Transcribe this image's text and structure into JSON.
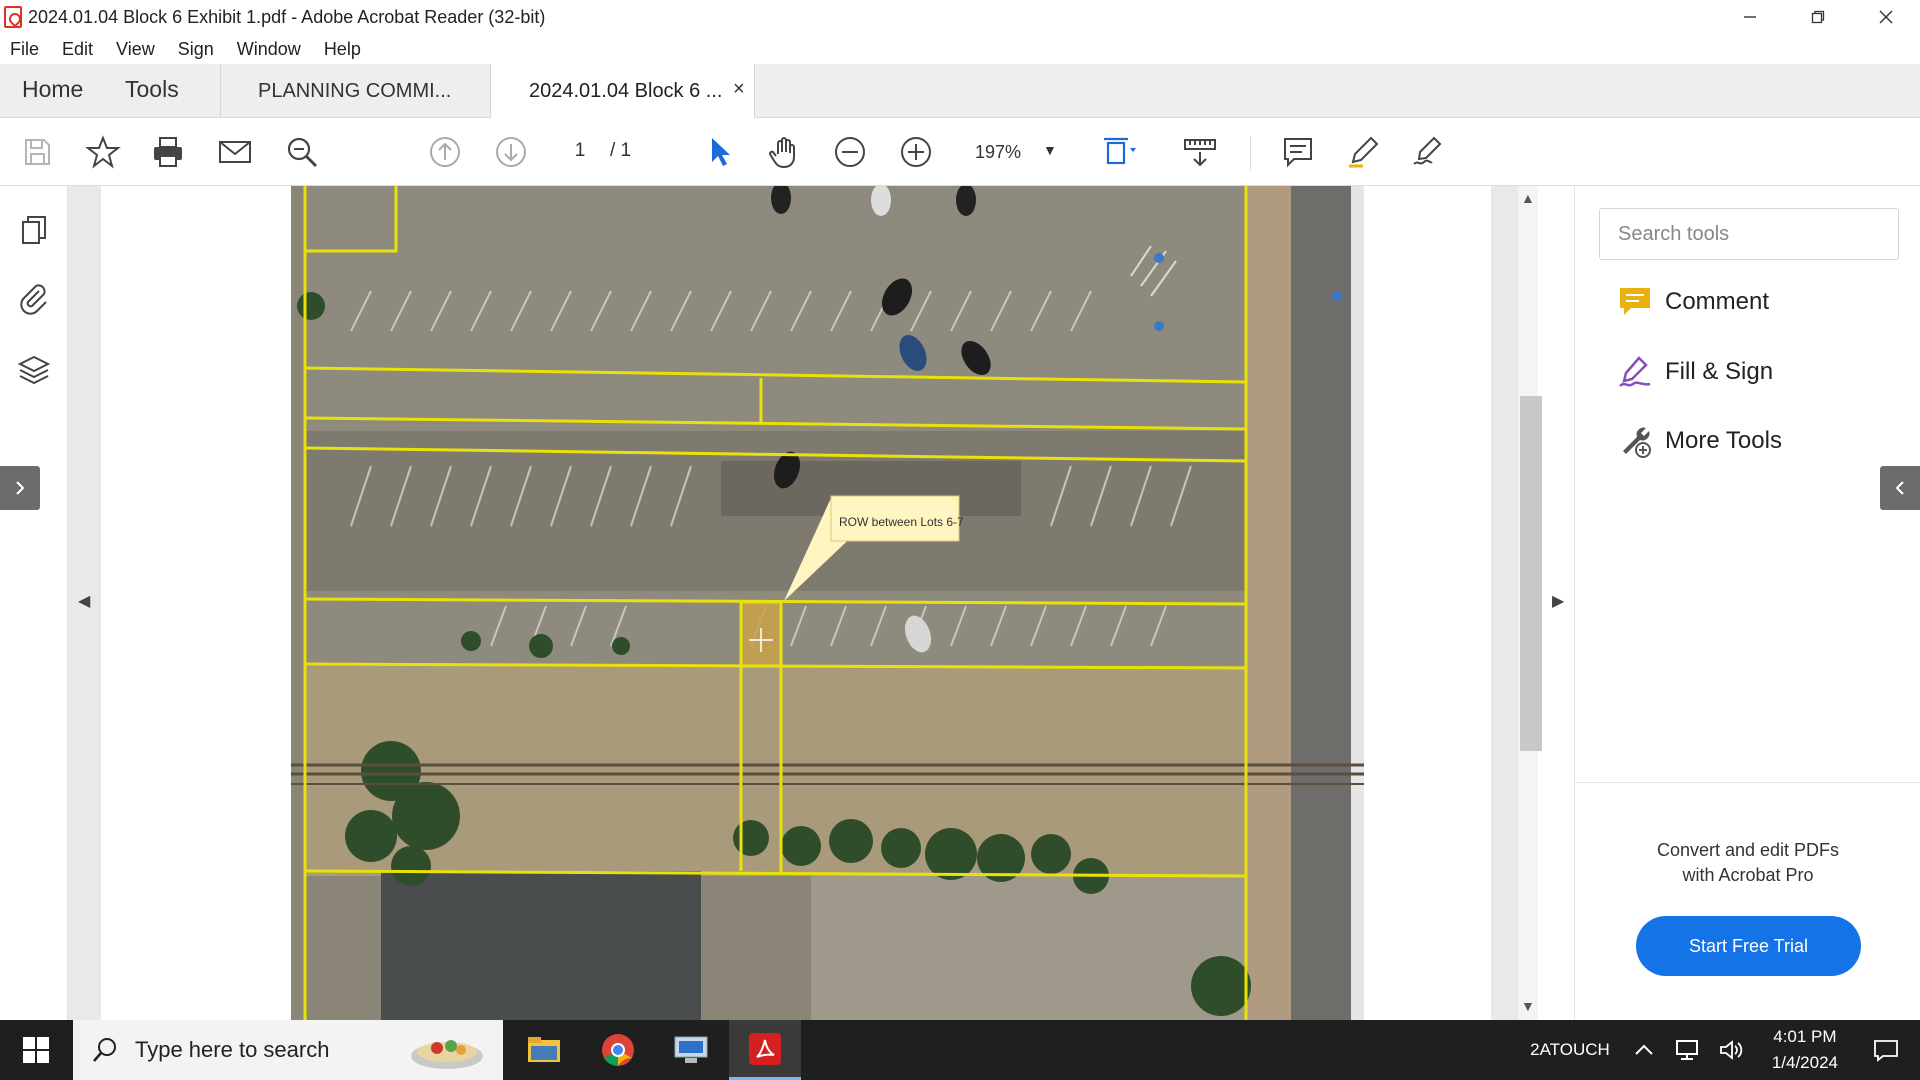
{
  "window": {
    "title": "2024.01.04 Block 6 Exhibit 1.pdf - Adobe Acrobat Reader (32-bit)"
  },
  "menu": [
    "File",
    "Edit",
    "View",
    "Sign",
    "Window",
    "Help"
  ],
  "tabs": {
    "home": "Home",
    "tools": "Tools",
    "doc1": "PLANNING COMMI...",
    "doc2": "2024.01.04 Block 6 ...",
    "close": "×"
  },
  "toolbar": {
    "page_current": "1",
    "page_total": "/ 1",
    "zoom": "197%"
  },
  "document": {
    "callout": "ROW between Lots 6-7"
  },
  "right_panel": {
    "search_placeholder": "Search tools",
    "tools": [
      {
        "label": "Comment",
        "icon": "comment-icon",
        "color": "#e8b10e"
      },
      {
        "label": "Fill & Sign",
        "icon": "fill-sign-icon",
        "color": "#8a4dbf"
      },
      {
        "label": "More Tools",
        "icon": "more-tools-icon",
        "color": "#555555"
      }
    ],
    "promo_line1": "Convert and edit PDFs",
    "promo_line2": "with Acrobat Pro",
    "trial_button": "Start Free Trial"
  },
  "taskbar": {
    "search_text": "Type here to search",
    "tray_label": "2ATOUCH",
    "time": "4:01 PM",
    "date": "1/4/2024"
  },
  "colors": {
    "accent": "#1473e6",
    "lot_lines": "#e8e20a",
    "highlight": "#c9a24a"
  }
}
